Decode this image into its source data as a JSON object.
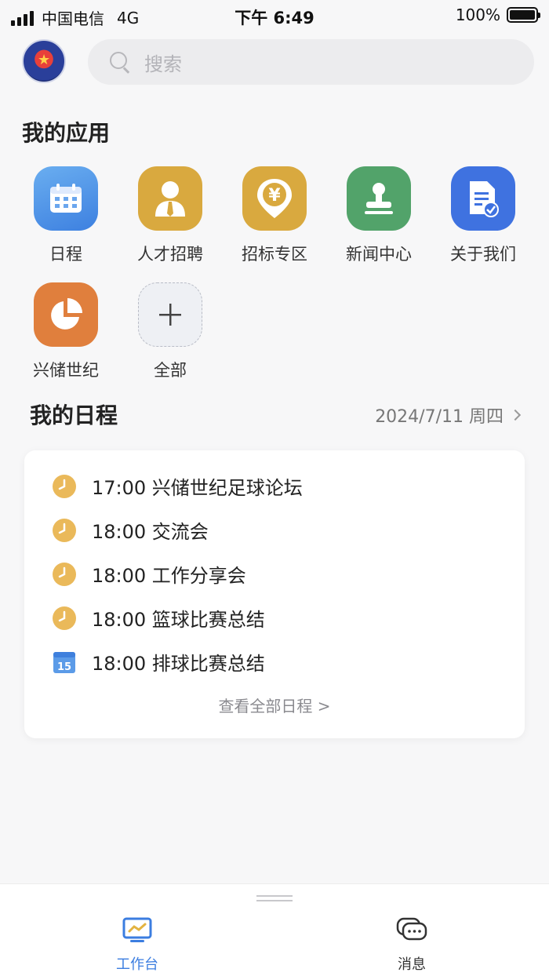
{
  "status_bar": {
    "carrier": "中国电信",
    "network": "4G",
    "time": "下午 6:49",
    "battery": "100%"
  },
  "header": {
    "search_placeholder": "搜索"
  },
  "apps_section": {
    "title": "我的应用",
    "items": [
      {
        "label": "日程",
        "icon": "calendar-icon",
        "color": "#4a92e6"
      },
      {
        "label": "人才招聘",
        "icon": "person-tie-icon",
        "color": "#d9a93f"
      },
      {
        "label": "招标专区",
        "icon": "yuan-location-icon",
        "color": "#d9a93f"
      },
      {
        "label": "新闻中心",
        "icon": "stamp-icon",
        "color": "#52a36a"
      },
      {
        "label": "关于我们",
        "icon": "document-check-icon",
        "color": "#3f72e0"
      },
      {
        "label": "兴储世纪",
        "icon": "pie-chart-icon",
        "color": "#e07f3d"
      },
      {
        "label": "全部",
        "icon": "plus-icon",
        "color": "#eef0f4"
      }
    ]
  },
  "schedule_section": {
    "title": "我的日程",
    "date": "2024/7/11 周四",
    "events": [
      {
        "text": "17:00 兴储世纪足球论坛",
        "icon": "clock-icon"
      },
      {
        "text": "18:00 交流会",
        "icon": "clock-icon"
      },
      {
        "text": "18:00 工作分享会",
        "icon": "clock-icon"
      },
      {
        "text": "18:00 篮球比赛总结",
        "icon": "clock-icon"
      },
      {
        "text": "18:00 排球比赛总结",
        "icon": "calendar-15-icon"
      }
    ],
    "calendar_day": "15",
    "view_all": "查看全部日程 >"
  },
  "tabbar": {
    "tabs": [
      {
        "label": "工作台",
        "active": true,
        "color": "#3b7de0"
      },
      {
        "label": "消息",
        "active": false,
        "color": "#333333"
      }
    ]
  }
}
